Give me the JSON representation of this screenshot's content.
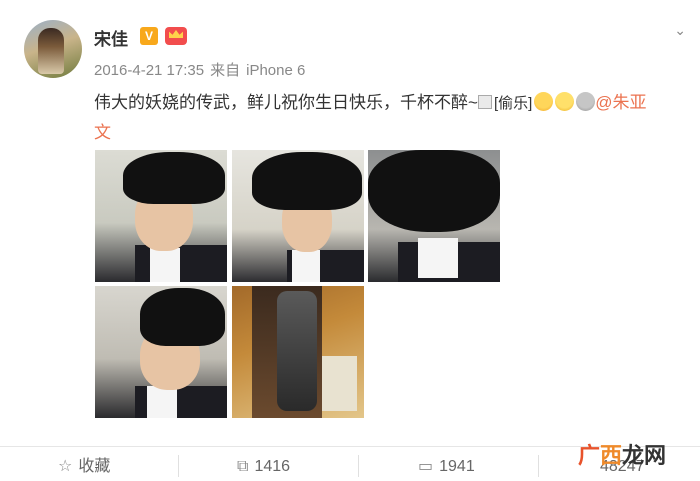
{
  "user": {
    "name": "宋佳",
    "verified_badge": "V",
    "member_icon": "crown-icon",
    "avatar": "avatar"
  },
  "menu_icon": "chevron-down-icon",
  "meta": {
    "timestamp": "2016-4-21 17:35",
    "source_prefix": "来自",
    "device": "iPhone 6"
  },
  "post": {
    "text": "伟大的妖娆的传武，鲜儿祝你生日快乐，千杯不醉~",
    "broken_emoji_alt": "[偷乐]",
    "mention_line1": "@朱亚",
    "mention_line2": "文"
  },
  "actions": {
    "favorite_label": "收藏",
    "repost_count": "1416",
    "comment_count": "1941",
    "like_count": "48247"
  },
  "watermark": {
    "part1": "广",
    "part2": "西",
    "part3": "龙网"
  },
  "colors": {
    "accent": "#eb7350",
    "verified": "#f8a81b",
    "text": "#333333",
    "muted": "#888888"
  }
}
